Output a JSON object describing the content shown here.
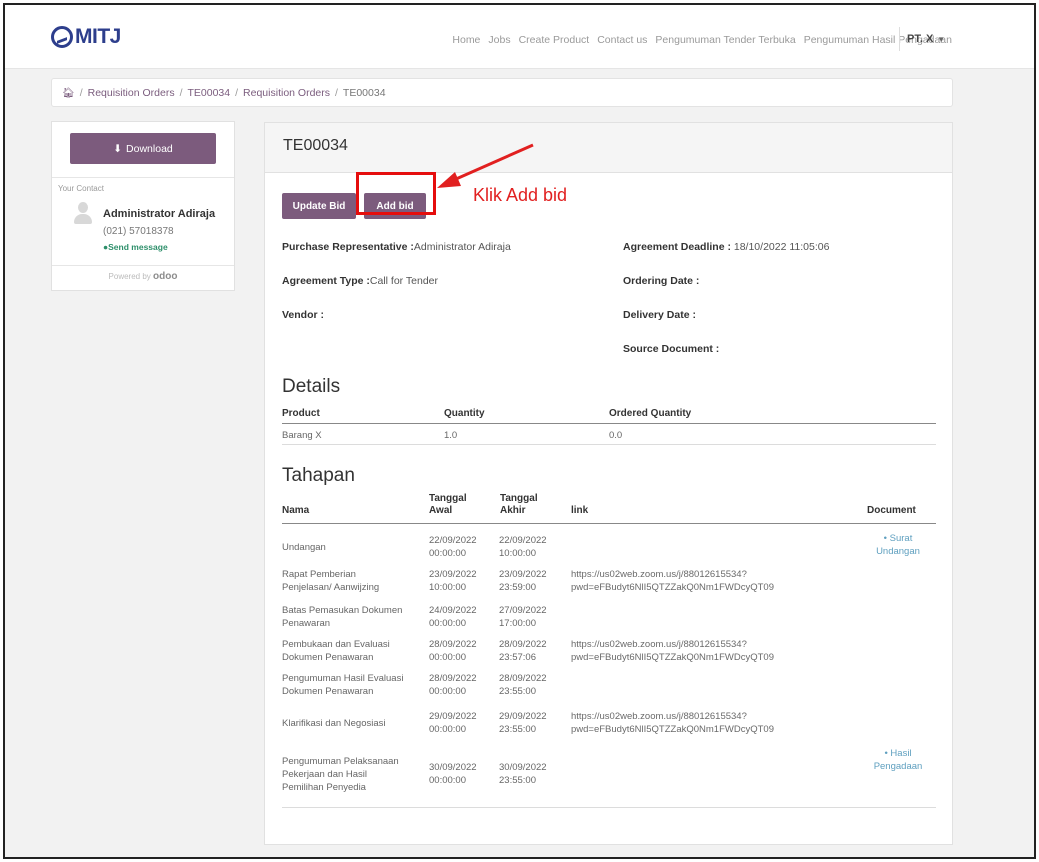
{
  "brand": {
    "logo_text": "MITJ"
  },
  "nav": {
    "items": [
      "Home",
      "Jobs",
      "Create Product",
      "Contact us",
      "Pengumuman Tender Terbuka",
      "Pengumuman Hasil Pengadaan"
    ],
    "user": "PT. X"
  },
  "breadcrumb": {
    "items": [
      "Requisition Orders",
      "TE00034",
      "Requisition Orders",
      "TE00034"
    ]
  },
  "sidebar": {
    "download_label": "Download",
    "contact_label": "Your Contact",
    "contact_name": "Administrator Adiraja",
    "contact_phone": "(021) 57018378",
    "send_message": "Send message",
    "powered_prefix": "Powered by",
    "powered_brand": "odoo"
  },
  "record": {
    "title": "TE00034",
    "update_bid": "Update Bid",
    "add_bid": "Add bid",
    "purchase_rep_label": "Purchase Representative :",
    "purchase_rep_value": "Administrator Adiraja",
    "agreement_type_label": "Agreement Type :",
    "agreement_type_value": "Call for Tender",
    "vendor_label": "Vendor :",
    "deadline_label": "Agreement Deadline :",
    "deadline_value": "18/10/2022 11:05:06",
    "ordering_label": "Ordering Date :",
    "delivery_label": "Delivery Date :",
    "source_label": "Source Document :"
  },
  "annotation": {
    "text": "Klik Add bid"
  },
  "details": {
    "heading": "Details",
    "columns": [
      "Product",
      "Quantity",
      "Ordered Quantity"
    ],
    "rows": [
      [
        "Barang X",
        "1.0",
        "0.0"
      ]
    ]
  },
  "tahapan": {
    "heading": "Tahapan",
    "columns": {
      "nama": "Nama",
      "awal_1": "Tanggal",
      "awal_2": "Awal",
      "akhir_1": "Tanggal",
      "akhir_2": "Akhir",
      "link": "link",
      "document": "Document"
    },
    "rows": [
      {
        "nama": [
          "Undangan"
        ],
        "awal": [
          "22/09/2022",
          "00:00:00"
        ],
        "akhir": [
          "22/09/2022",
          "10:00:00"
        ],
        "link": [],
        "doc": [
          "Surat",
          "Undangan"
        ]
      },
      {
        "nama": [
          "Rapat Pemberian",
          "Penjelasan/ Aanwijzing"
        ],
        "awal": [
          "23/09/2022",
          "10:00:00"
        ],
        "akhir": [
          "23/09/2022",
          "23:59:00"
        ],
        "link": [
          "https://us02web.zoom.us/j/88012615534?",
          "pwd=eFBudyt6NlI5QTZZakQ0Nm1FWDcyQT09"
        ],
        "doc": []
      },
      {
        "nama": [
          "Batas Pemasukan Dokumen",
          "Penawaran"
        ],
        "awal": [
          "24/09/2022",
          "00:00:00"
        ],
        "akhir": [
          "27/09/2022",
          "17:00:00"
        ],
        "link": [],
        "doc": []
      },
      {
        "nama": [
          "Pembukaan dan Evaluasi",
          "Dokumen Penawaran"
        ],
        "awal": [
          "28/09/2022",
          "00:00:00"
        ],
        "akhir": [
          "28/09/2022",
          "23:57:06"
        ],
        "link": [
          "https://us02web.zoom.us/j/88012615534?",
          "pwd=eFBudyt6NlI5QTZZakQ0Nm1FWDcyQT09"
        ],
        "doc": []
      },
      {
        "nama": [
          "Pengumuman Hasil Evaluasi",
          "Dokumen Penawaran"
        ],
        "awal": [
          "28/09/2022",
          "00:00:00"
        ],
        "akhir": [
          "28/09/2022",
          "23:55:00"
        ],
        "link": [],
        "doc": []
      },
      {
        "nama": [
          "Klarifikasi dan Negosiasi"
        ],
        "awal": [
          "29/09/2022",
          "00:00:00"
        ],
        "akhir": [
          "29/09/2022",
          "23:55:00"
        ],
        "link": [
          "https://us02web.zoom.us/j/88012615534?",
          "pwd=eFBudyt6NlI5QTZZakQ0Nm1FWDcyQT09"
        ],
        "doc": []
      },
      {
        "nama": [
          "Pengumuman Pelaksanaan",
          "Pekerjaan dan Hasil",
          "Pemilihan Penyedia"
        ],
        "awal": [
          "30/09/2022",
          "00:00:00"
        ],
        "akhir": [
          "30/09/2022",
          "23:55:00"
        ],
        "link": [],
        "doc": [
          "Hasil",
          "Pengadaan"
        ]
      }
    ]
  }
}
